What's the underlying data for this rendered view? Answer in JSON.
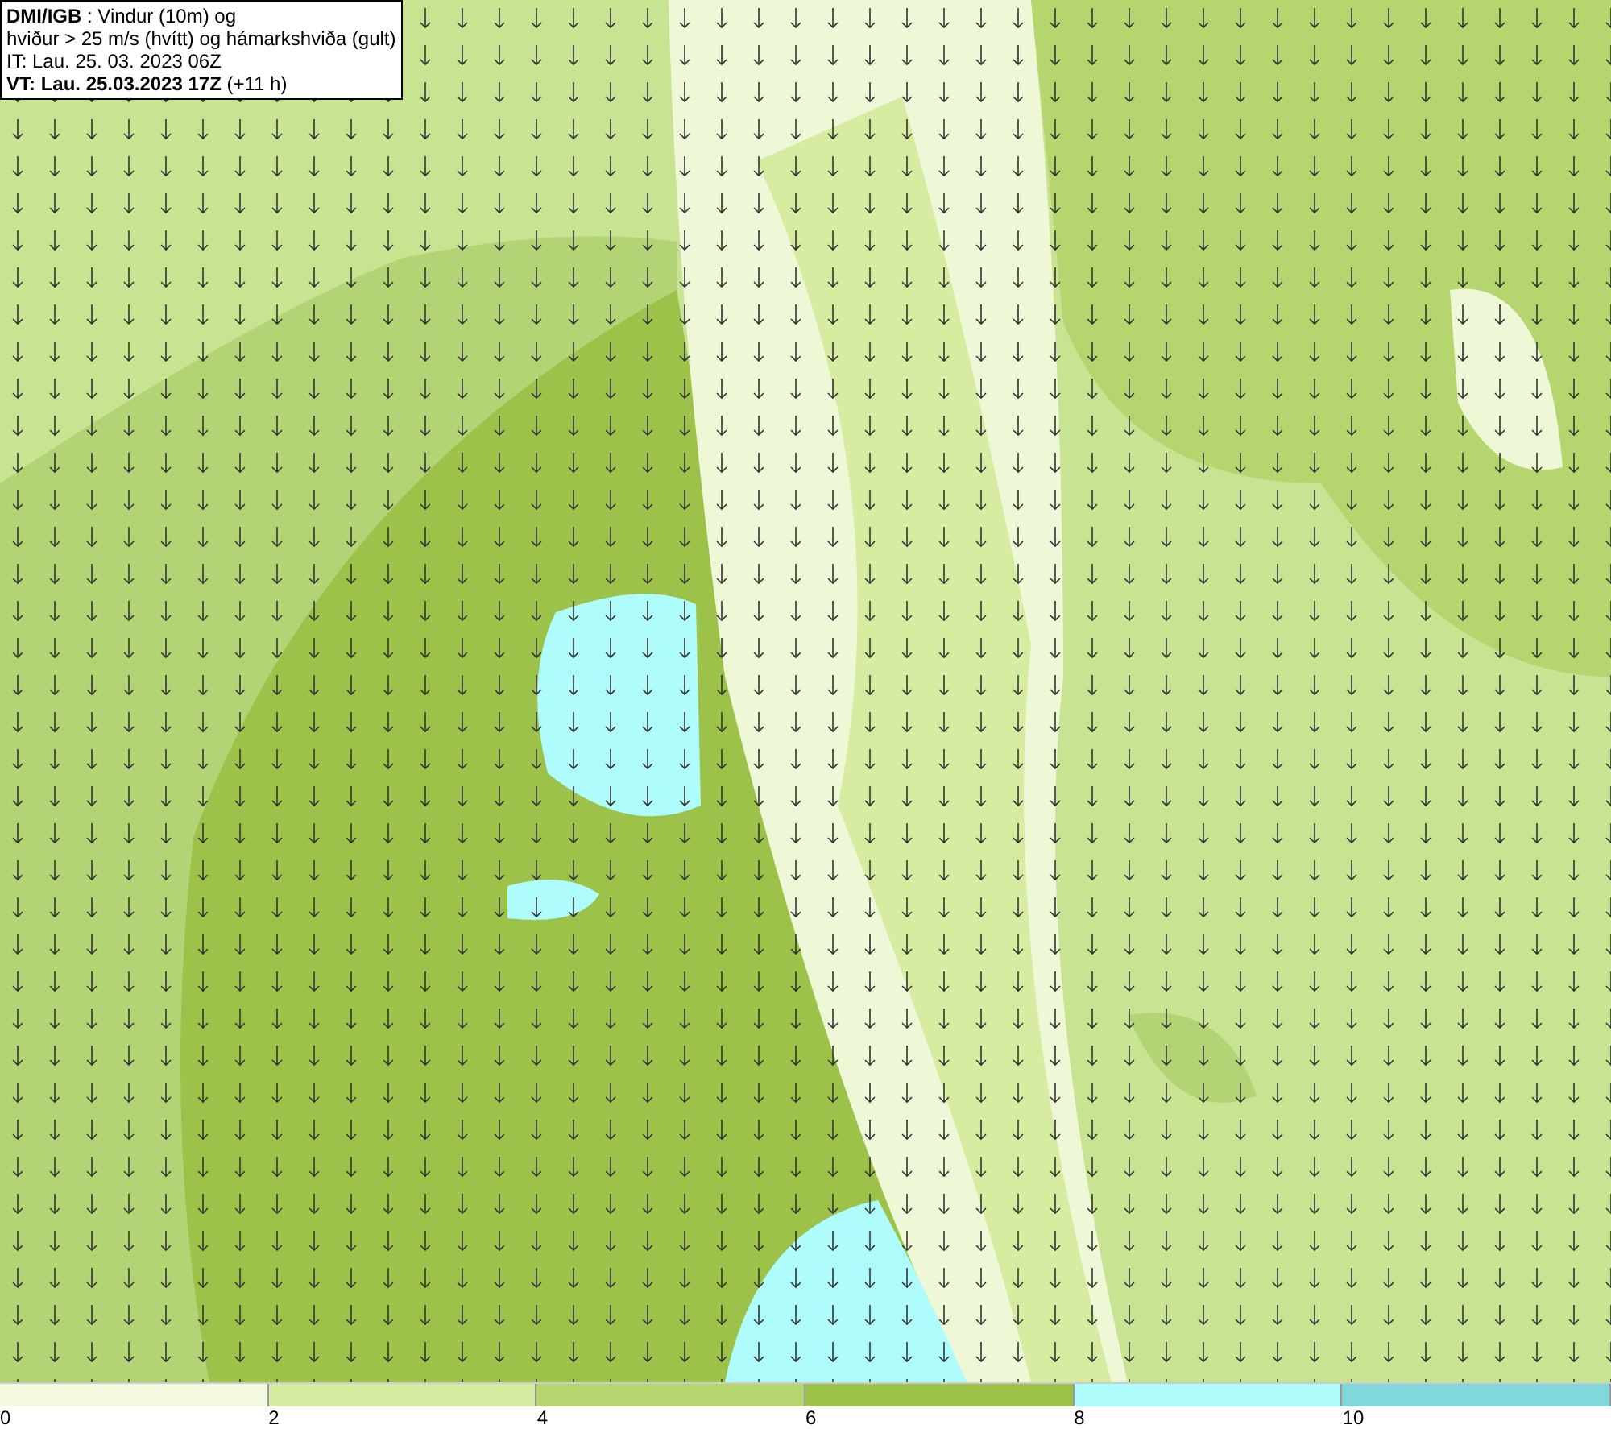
{
  "header": {
    "lines": [
      "**DMI/IGB** : Vindur (10m) og",
      "hviður > 25 m/s (hvítt) og hámarkshviða (gult)",
      "IT: Lau. 25. 03. 2023 06Z",
      "**VT: Lau. 25.03.2023 17Z** (+11 h)"
    ]
  },
  "legend": [
    {
      "label": "0",
      "color": "#f4fadf"
    },
    {
      "label": "2",
      "color": "#d6eca0"
    },
    {
      "label": "4",
      "color": "#b5d66e"
    },
    {
      "label": "6",
      "color": "#9cc24a"
    },
    {
      "label": "8",
      "color": "#aefcfc"
    },
    {
      "label": "10",
      "color": "#80d8da"
    }
  ]
}
